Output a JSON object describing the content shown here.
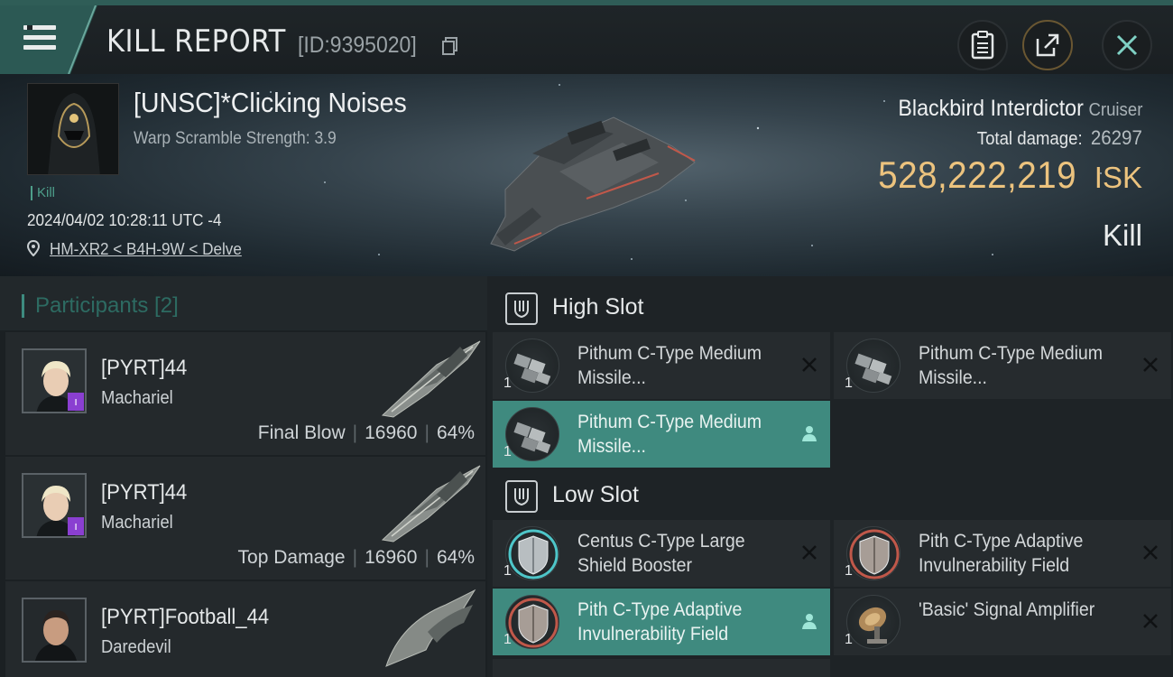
{
  "header": {
    "title": "KILL REPORT",
    "report_id": "[ID:9395020]",
    "icons": [
      "menu-icon",
      "copy-icon",
      "clipboard-icon",
      "share-icon",
      "close-icon"
    ]
  },
  "victim": {
    "name": "[UNSC]*Clicking Noises",
    "warp_scramble": "Warp Scramble Strength: 3.9",
    "tag": "Kill",
    "datetime": "2024/04/02 10:28:11 UTC -4",
    "location": "HM-XR2 < B4H-9W < Delve",
    "ship_name": "Blackbird Interdictor",
    "ship_class": "Cruiser",
    "total_damage_label": "Total damage:",
    "total_damage": "26297",
    "isk_value": "528,222,219",
    "isk_unit": "ISK",
    "result": "Kill"
  },
  "participants": {
    "title": "Participants [2]",
    "rows": [
      {
        "name": "[PYRT]44",
        "ship": "Machariel",
        "label": "Final Blow",
        "damage": "16960",
        "percent": "64%"
      },
      {
        "name": "[PYRT]44",
        "ship": "Machariel",
        "label": "Top Damage",
        "damage": "16960",
        "percent": "64%"
      },
      {
        "name": "[PYRT]Football_44",
        "ship": "Daredevil",
        "label": "",
        "damage": "",
        "percent": ""
      }
    ]
  },
  "slots": {
    "high": {
      "label": "High Slot",
      "modules": [
        {
          "name": "Pithum C-Type Medium Missile...",
          "qty": "1",
          "status": "destroyed"
        },
        {
          "name": "Pithum C-Type Medium Missile...",
          "qty": "1",
          "status": "destroyed"
        },
        {
          "name": "Pithum C-Type Medium Missile...",
          "qty": "1",
          "status": "dropped"
        }
      ]
    },
    "low": {
      "label": "Low Slot",
      "modules": [
        {
          "name": "Centus C-Type Large Shield Booster",
          "qty": "1",
          "status": "destroyed"
        },
        {
          "name": "Pith C-Type Adaptive Invulnerability Field",
          "qty": "1",
          "status": "destroyed"
        },
        {
          "name": "Pith C-Type Adaptive Invulnerability Field",
          "qty": "1",
          "status": "dropped"
        },
        {
          "name": "'Basic' Signal Amplifier",
          "qty": "1",
          "status": "destroyed"
        }
      ]
    }
  },
  "colors": {
    "accent": "#3f8a7f",
    "isk": "#ecc37e",
    "badge": "#8a3fd1"
  }
}
